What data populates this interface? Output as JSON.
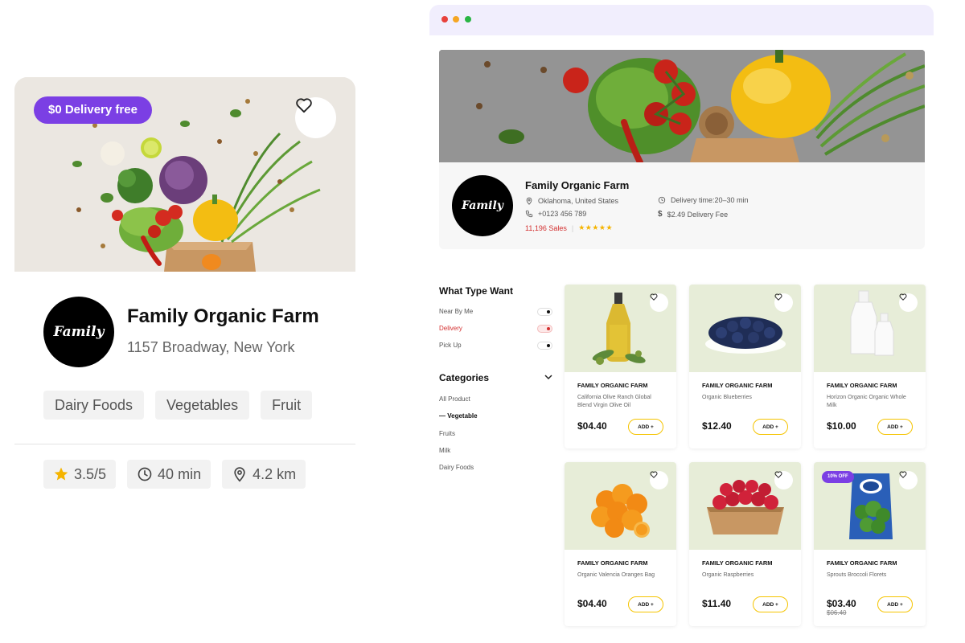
{
  "colors": {
    "accent_purple": "#7b3fe4",
    "sales_red": "#d32f2f",
    "star_gold": "#f5b400",
    "add_border": "#f5c400",
    "product_bg": "#e7edd8"
  },
  "card": {
    "badge": "$0 Delivery free",
    "favorite_icon": "heart-icon",
    "logo_text": "Family",
    "title": "Family Organic Farm",
    "address": "1157 Broadway, New York",
    "tags": [
      "Dairy Foods",
      "Vegetables",
      "Fruit"
    ],
    "rating": "3.5/5",
    "time": "40 min",
    "distance": "4.2 km"
  },
  "store": {
    "logo_text": "Family",
    "name": "Family Organic Farm",
    "location": "Oklahoma, United States",
    "phone": "+0123 456 789",
    "sales": "11,196 Sales",
    "stars": "★★★★★",
    "delivery_time": "Delivery time:20–30 min",
    "delivery_fee": "$2.49 Delivery Fee"
  },
  "filters": {
    "title": "What Type Want",
    "items": [
      {
        "label": "Near By Me",
        "active": false
      },
      {
        "label": "Delivery",
        "active": true
      },
      {
        "label": "Pick Up",
        "active": false
      }
    ]
  },
  "categories": {
    "title": "Categories",
    "items": [
      {
        "label": "All Product",
        "active": false
      },
      {
        "label": "— Vegetable",
        "active": true
      },
      {
        "label": "Fruits",
        "active": false
      },
      {
        "label": "Milk",
        "active": false
      },
      {
        "label": "Dairy Foods",
        "active": false
      }
    ]
  },
  "products": [
    {
      "store": "FAMILY ORGANIC FARM",
      "name": "California Olive Ranch Global Blend Virgin Olive Oil",
      "price": "$04.40",
      "old_price": "",
      "badge": "",
      "add": "ADD +",
      "image": "olive-oil"
    },
    {
      "store": "FAMILY ORGANIC FARM",
      "name": "Organic Blueberries",
      "price": "$12.40",
      "old_price": "",
      "badge": "",
      "add": "ADD +",
      "image": "blueberries"
    },
    {
      "store": "FAMILY ORGANIC FARM",
      "name": "Horizon Organic Organic Whole Milk",
      "price": "$10.00",
      "old_price": "",
      "badge": "",
      "add": "ADD +",
      "image": "milk"
    },
    {
      "store": "FAMILY ORGANIC FARM",
      "name": "Organic Valencia Oranges Bag",
      "price": "$04.40",
      "old_price": "",
      "badge": "",
      "add": "ADD +",
      "image": "oranges"
    },
    {
      "store": "FAMILY ORGANIC FARM",
      "name": "Organic Raspberries",
      "price": "$11.40",
      "old_price": "",
      "badge": "",
      "add": "ADD +",
      "image": "raspberries"
    },
    {
      "store": "FAMILY ORGANIC FARM",
      "name": "Sprouts Broccoli Florets",
      "price": "$03.40",
      "old_price": "$06.40",
      "badge": "10% OFF",
      "add": "ADD +",
      "image": "broccoli-bag"
    }
  ]
}
